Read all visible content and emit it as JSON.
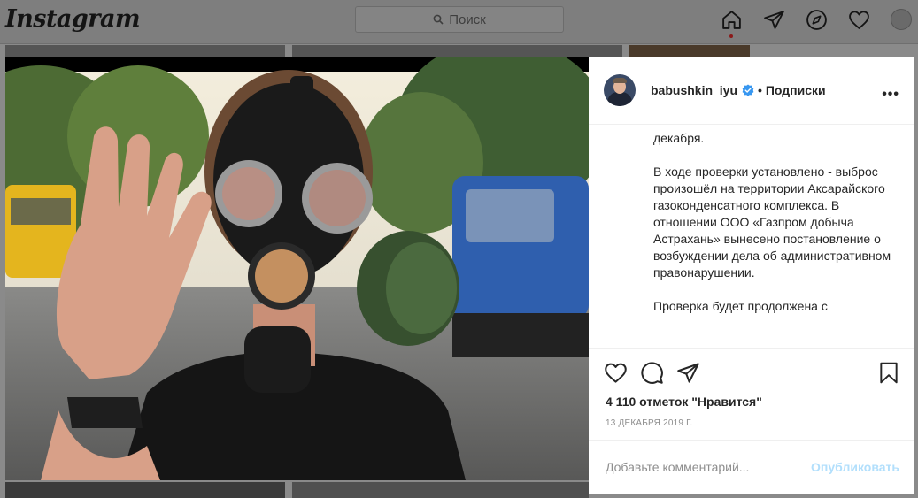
{
  "nav": {
    "logo": "Instagram",
    "search_placeholder": "Поиск",
    "icons": [
      "home-icon",
      "direct-icon",
      "explore-icon",
      "activity-heart-icon",
      "profile-avatar"
    ]
  },
  "post": {
    "username": "babushkin_iyu",
    "verified": true,
    "follow_label": "• Подписки",
    "more_label": "•••",
    "caption_paragraphs": [
      "декабря.",
      "В ходе проверки установлено - выброс произошёл на территории Аксарайского газоконденсатного комплекса. В отношении ООО «Газпром добыча Астрахань» вынесено постановление о возбуждении дела об административном правонарушении.",
      "Проверка будет продолжена с"
    ],
    "likes_text": "4 110 отметок \"Нравится\"",
    "date_text": "13 ДЕКАБРЯ 2019 Г.",
    "comment_placeholder": "Добавьте комментарий...",
    "publish_label": "Опубликовать"
  },
  "colors": {
    "accent_link": "#b2dffc",
    "verified_blue": "#3897f0",
    "overlay_bg": "#8a8a8a"
  }
}
